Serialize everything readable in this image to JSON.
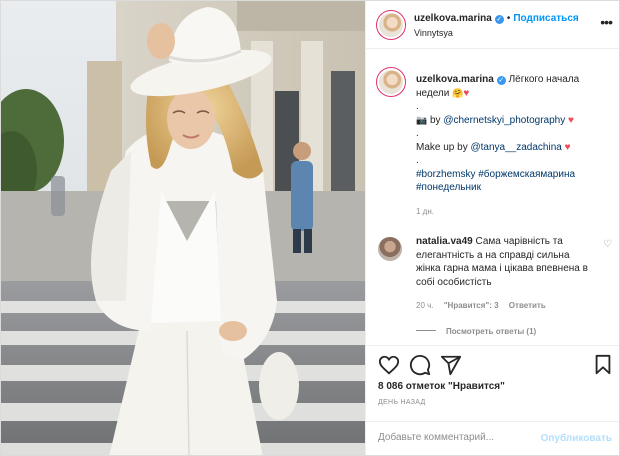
{
  "post": {
    "author": {
      "username": "uzelkova.marina",
      "verified_icon": "verified-badge-icon",
      "follow_label": "Подписаться",
      "location": "Vinnytsya",
      "more_icon": "ellipsis-icon"
    },
    "caption": {
      "username": "uzelkova.marina",
      "line1_text": "Лёгкого начала",
      "line2_text": "недели",
      "dot1": ".",
      "camera_emoji": "camera-icon",
      "by_text": "by",
      "photographer": "@chernetskyi_photography",
      "dot2": ".",
      "makeup_text": "Make up by",
      "makeup_artist": "@tanya__zadachina",
      "dot3": ".",
      "hashtag1": "#borzhemsky",
      "hashtag2": "#боржемскаямарина",
      "hashtag3": "#понедельник",
      "time": "1 дн."
    },
    "comment": {
      "username": "natalia.va49",
      "text": "Сама чарівність та елегантність а на справді сильна жінка гарна мама і цікава впевнена в собі особистість",
      "time": "20 ч.",
      "likes_label": "\"Нравится\": 3",
      "reply_label": "Ответить",
      "view_replies": "Посмотреть ответы (1)"
    },
    "actions": {
      "like_icon": "heart-outline-icon",
      "comment_icon": "comment-bubble-icon",
      "share_icon": "paper-plane-icon",
      "save_icon": "bookmark-icon"
    },
    "likes_count": "8 086 отметок \"Нравится\"",
    "date_label": "ДЕНЬ НАЗАД",
    "add_comment": {
      "placeholder": "Добавьте комментарий...",
      "post_label": "Опубликовать"
    }
  },
  "colors": {
    "link_blue": "#0095f6",
    "tag_navy": "#00376b",
    "heart_red": "#ed4956",
    "muted_gray": "#8e8e8e",
    "post_disabled": "#b2dffc"
  }
}
